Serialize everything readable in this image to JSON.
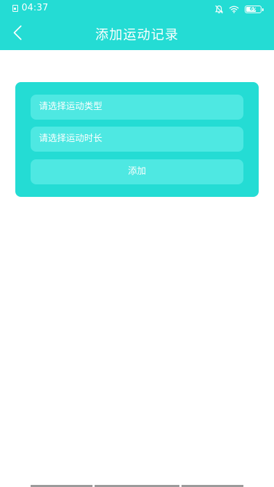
{
  "status_bar": {
    "time": "04:37",
    "battery": "65",
    "icons": [
      "sim-icon",
      "bell-off-icon",
      "wifi-icon",
      "battery-icon"
    ]
  },
  "header": {
    "title": "添加运动记录",
    "back_icon": "chevron-left-icon"
  },
  "form": {
    "type_placeholder": "请选择运动类型",
    "duration_placeholder": "请选择运动时长",
    "add_label": "添加"
  },
  "colors": {
    "accent": "#24dcd4",
    "field_bg": "#4ee8e2",
    "text": "#ffffff"
  }
}
